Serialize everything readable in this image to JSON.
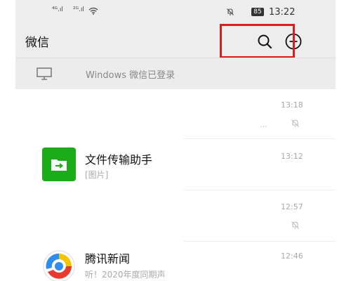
{
  "status_bar": {
    "signal1": "⁴ᴳ.ıl",
    "signal2": "²ᴳ.ıl",
    "battery": "85",
    "time": "13:22"
  },
  "header": {
    "title": "微信",
    "search_icon": "search-icon",
    "add_icon": "plus-circle-icon"
  },
  "banner": {
    "text": "Windows 微信已登录",
    "icon": "monitor-icon"
  },
  "chats": [
    {
      "name": "",
      "preview": "...",
      "time": "13:18",
      "muted": true
    },
    {
      "name": "文件传输助手",
      "preview": "[图片]",
      "time": "13:12",
      "muted": false,
      "avatar_color": "#1aad19"
    },
    {
      "name": "",
      "preview": "",
      "time": "12:57",
      "muted": true
    },
    {
      "name": "腾讯新闻",
      "preview": "听！2020年度同期声",
      "time": "12:46",
      "muted": false
    }
  ],
  "colors": {
    "highlight": "#e01b1b",
    "file_transfer_green": "#1aad19"
  }
}
